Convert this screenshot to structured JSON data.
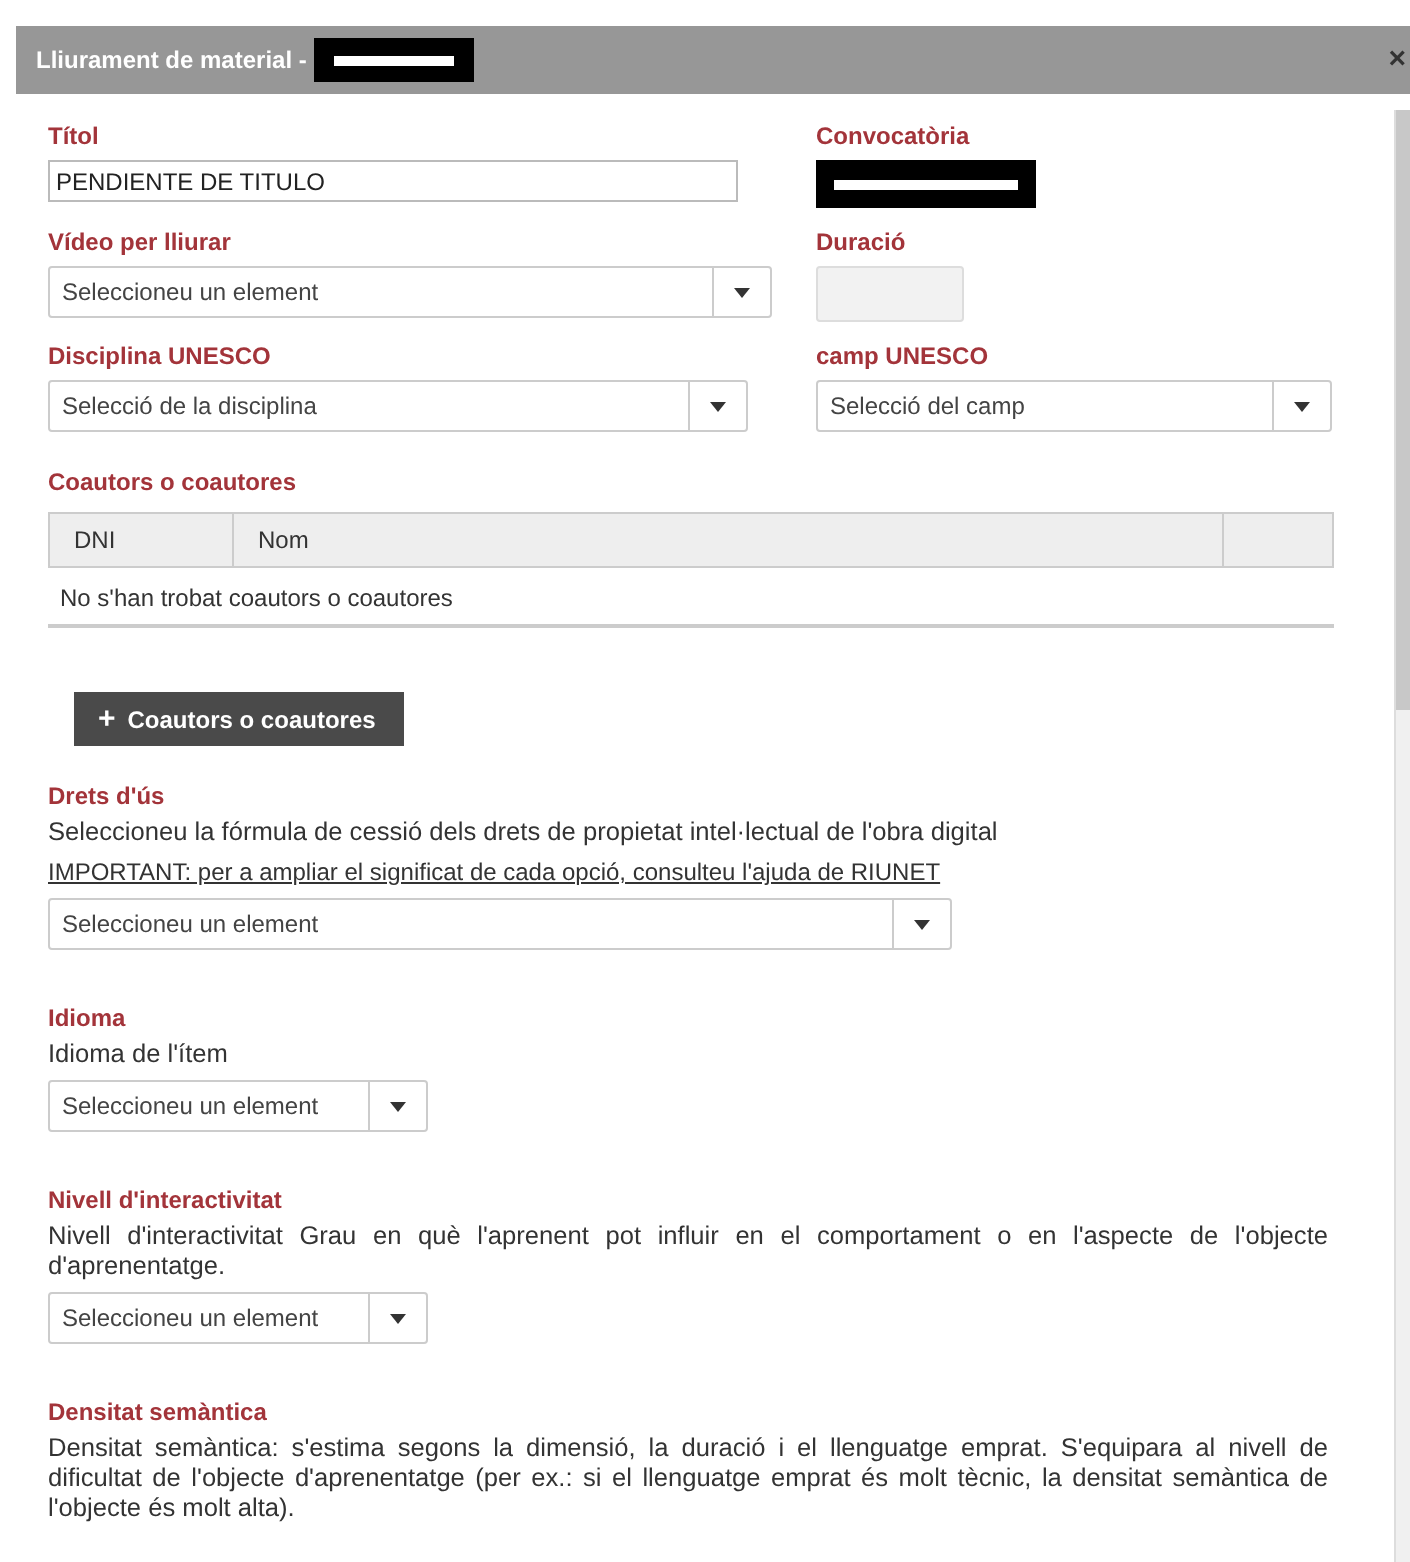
{
  "window": {
    "title": "Lliurament de material -",
    "close": "×"
  },
  "title_field": {
    "label": "Títol",
    "value": "PENDIENTE DE TITULO"
  },
  "call": {
    "label": "Convocatòria"
  },
  "video": {
    "label": "Vídeo per lliurar",
    "placeholder": "Seleccioneu un element"
  },
  "duration": {
    "label": "Duració"
  },
  "discipline": {
    "label": "Disciplina UNESCO",
    "placeholder": "Selecció de la disciplina"
  },
  "field_unesco": {
    "label": "camp UNESCO",
    "placeholder": "Selecció del camp"
  },
  "coauthors": {
    "label": "Coautors o coautores",
    "columns": [
      "DNI",
      "Nom"
    ],
    "empty": "No s'han trobat coautors o coautores",
    "add_button": {
      "icon": "+",
      "label": "Coautors o coautores"
    }
  },
  "sections": [
    {
      "label": "Drets d'ús",
      "description": "Seleccioneu la fórmula de cessió dels drets de propietat intel·lectual de l'obra digital",
      "link": "IMPORTANT: per a ampliar el significat de cada opció, consulteu l'ajuda de RIUNET",
      "select": {
        "kind": "wide",
        "placeholder": "Seleccioneu un element"
      }
    },
    {
      "label": "Idioma",
      "description": "Idioma de l'ítem",
      "select": {
        "kind": "narrow",
        "placeholder": "Seleccioneu un element"
      }
    },
    {
      "label": "Nivell d'interactivitat",
      "description": "Nivell d'interactivitat Grau en què l'aprenent pot influir en el comportament o en l'aspecte de l'objecte d'aprenentatge.",
      "select": {
        "kind": "narrow",
        "placeholder": "Seleccioneu un element"
      }
    },
    {
      "label": "Densitat semàntica",
      "description": "Densitat semàntica: s'estima segons la dimensió, la duració i el llenguatge emprat. S'equipara al nivell de dificultat de l'objecte d'aprenentatge (per ex.: si el llenguatge emprat és molt tècnic, la densitat semàntica de l'objecte és molt alta)."
    }
  ]
}
